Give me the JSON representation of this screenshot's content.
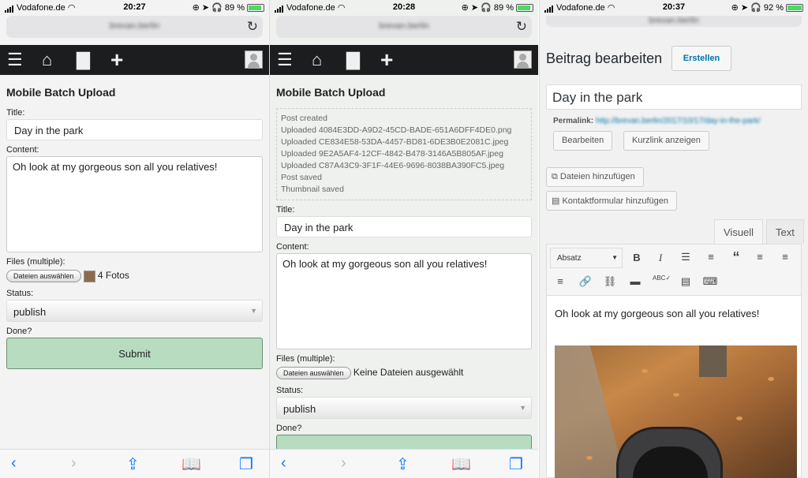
{
  "colors": {
    "nav_bg": "#1b1d1f",
    "submit_bg": "#b7dcbf",
    "ios_blue": "#0a7aff",
    "wp_link": "#0073aa",
    "battery_green": "#4cd964"
  },
  "panel1": {
    "status": {
      "carrier": "Vodafone.de",
      "time": "20:27",
      "battery": "89 %"
    },
    "url": "brevan.berlin",
    "nav_icons": [
      "menu-icon",
      "home-icon",
      "comment-icon",
      "plus-icon",
      "avatar-icon"
    ],
    "heading": "Mobile Batch Upload",
    "title_label": "Title:",
    "title_value": "Day in the park",
    "content_label": "Content:",
    "content_value": "Oh look at my gorgeous son all you relatives!",
    "files_label": "Files (multiple):",
    "file_button": "Dateien auswählen",
    "file_status": "4 Fotos",
    "status_label": "Status:",
    "status_value": "publish",
    "done_label": "Done?",
    "submit_label": "Submit"
  },
  "panel2": {
    "status": {
      "carrier": "Vodafone.de",
      "time": "20:28",
      "battery": "89 %"
    },
    "url": "brevan.berlin",
    "heading": "Mobile Batch Upload",
    "log": [
      "Post created",
      "Uploaded 4084E3DD-A9D2-45CD-BADE-651A6DFF4DE0.png",
      "Uploaded CE834E58-53DA-4457-BD81-6DE3B0E2081C.jpeg",
      "Uploaded 9E2A5AF4-12CF-4842-B478-3146A5B805AF.jpeg",
      "Uploaded C87A43C9-3F1F-44E6-9696-8038BA390FC5.jpeg",
      "Post saved",
      "Thumbnail saved"
    ],
    "title_label": "Title:",
    "title_value": "Day in the park",
    "content_label": "Content:",
    "content_value": "Oh look at my gorgeous son all you relatives!",
    "files_label": "Files (multiple):",
    "file_button": "Dateien auswählen",
    "file_status": "Keine Dateien ausgewählt",
    "status_label": "Status:",
    "status_value": "publish",
    "done_label": "Done?"
  },
  "panel3": {
    "status": {
      "carrier": "Vodafone.de",
      "time": "20:37",
      "battery": "92 %"
    },
    "url": "brevan.berlin",
    "page_title": "Beitrag bearbeiten",
    "new_button": "Erstellen",
    "post_title": "Day in the park",
    "permalink_label": "Permalink:",
    "permalink_url": "http://brevan.berlin/2017/10/17/day-in-the-park/",
    "edit_button": "Bearbeiten",
    "shortlink_button": "Kurzlink anzeigen",
    "add_media_button": "Dateien hinzufügen",
    "add_form_button": "Kontaktformular hinzufügen",
    "tab_visual": "Visuell",
    "tab_text": "Text",
    "format_select": "Absatz",
    "editor_text": "Oh look at my gorgeous son all you relatives!"
  }
}
